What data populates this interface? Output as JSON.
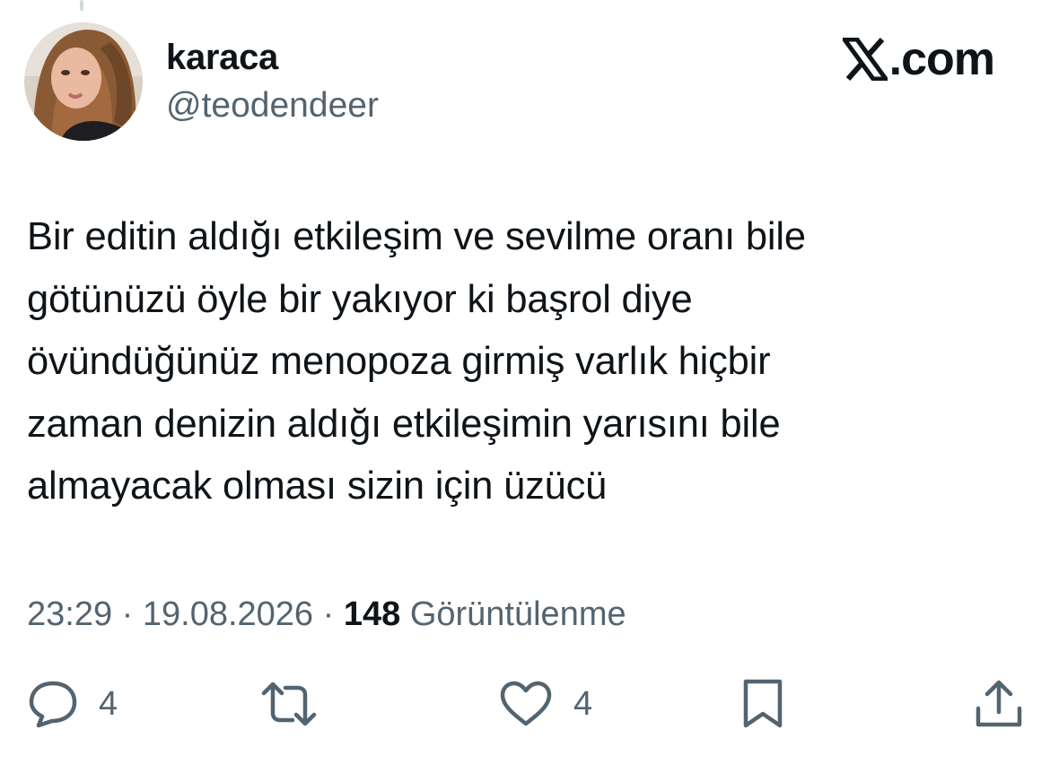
{
  "author": {
    "display_name": "karaca",
    "handle": "@teodendeer"
  },
  "brand": {
    "label": ".com"
  },
  "tweet": {
    "text": "Bir editin aldığı etkileşim ve sevilme oranı bile\ngötünüzü öyle bir yakıyor ki başrol diye\növündüğünüz menopoza girmiş varlık hiçbir\nzaman denizin aldığı etkileşimin yarısını bile\nalmayacak olması sizin için üzücü"
  },
  "meta": {
    "time": "23:29",
    "separator": " · ",
    "date": "19.08.2026",
    "views_count": "148",
    "views_label": "Görüntülenme"
  },
  "actions": {
    "reply_count": "4",
    "like_count": "4"
  },
  "icons": {
    "reply": "speech-bubble-icon",
    "retweet": "retweet-arrows-icon",
    "like": "heart-icon",
    "bookmark": "bookmark-icon",
    "share": "share-upload-icon",
    "brand": "x-logo-icon"
  },
  "colors": {
    "text_primary": "#0f1419",
    "text_secondary": "#536471",
    "background": "#ffffff"
  }
}
